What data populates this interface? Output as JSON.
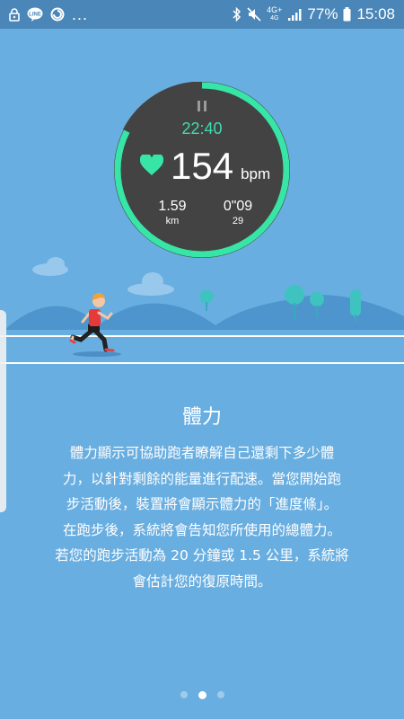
{
  "status_bar": {
    "more_dots": "...",
    "network_type": "4G+",
    "network_sub": "4G",
    "battery_percent": "77%",
    "time": "15:08",
    "icons": [
      "lock-icon",
      "line-app-icon",
      "circular-app-icon",
      "bluetooth-icon",
      "mute-icon",
      "signal-icon",
      "battery-icon"
    ]
  },
  "watch": {
    "elapsed_time": "22:40",
    "heart_rate": "154",
    "heart_rate_unit": "bpm",
    "distance_value": "1.59",
    "distance_unit": "km",
    "pace_value": "0\"09",
    "pace_sub": "29",
    "ring_color": "#37e6a6",
    "accent_color": "#3fdcae"
  },
  "content": {
    "title": "體力",
    "lines": [
      "體力顯示可協助跑者瞭解自己還剩下多少體",
      "力，以針對剩餘的能量進行配速。當您開始跑",
      "步活動後，裝置將會顯示體力的「進度條」。",
      "在跑步後，系統將會告知您所使用的總體力。",
      "若您的跑步活動為 20 分鐘或 1.5 公里，系統將",
      "會估計您的復原時間。"
    ]
  },
  "pager": {
    "pages": 3,
    "current_page": 2
  }
}
